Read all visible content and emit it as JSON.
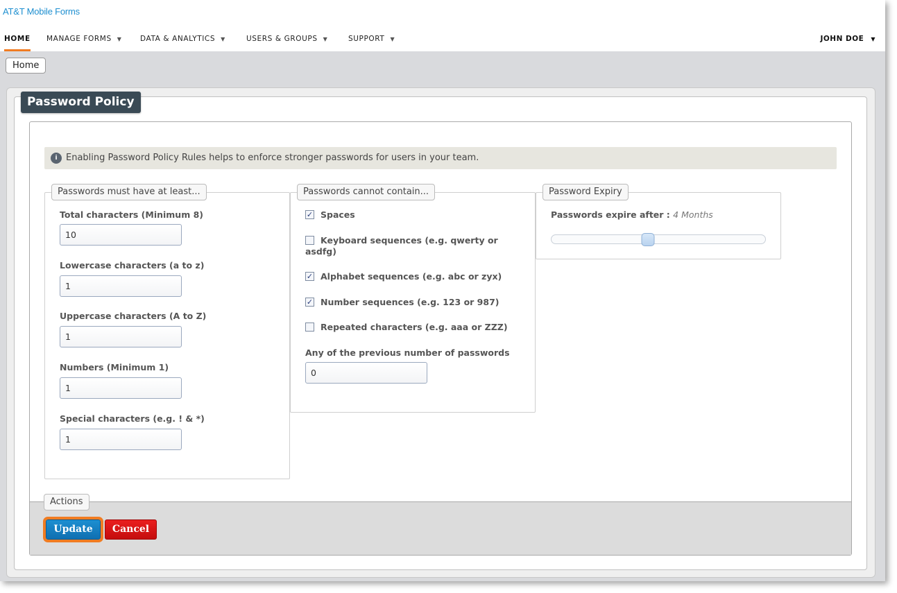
{
  "app": {
    "logo": "AT&T Mobile Forms"
  },
  "nav": {
    "items": [
      {
        "label": "HOME",
        "active": true,
        "has_caret": false
      },
      {
        "label": "MANAGE FORMS",
        "active": false,
        "has_caret": true
      },
      {
        "label": "DATA & ANALYTICS",
        "active": false,
        "has_caret": true
      },
      {
        "label": "USERS & GROUPS",
        "active": false,
        "has_caret": true
      },
      {
        "label": "SUPPORT",
        "active": false,
        "has_caret": true
      }
    ],
    "user": "JOHN DOE",
    "caret": "▼"
  },
  "breadcrumb": {
    "home": "Home"
  },
  "panel": {
    "title": "Password Policy"
  },
  "info": {
    "text": "Enabling Password Policy Rules helps to enforce stronger passwords for users in your team."
  },
  "must_have": {
    "legend": "Passwords must have at least...",
    "fields": [
      {
        "label": "Total characters (Minimum 8)",
        "value": "10"
      },
      {
        "label": "Lowercase characters (a to z)",
        "value": "1"
      },
      {
        "label": "Uppercase characters (A to Z)",
        "value": "1"
      },
      {
        "label": "Numbers (Minimum 1)",
        "value": "1"
      },
      {
        "label": "Special characters (e.g. ! & *)",
        "value": "1"
      }
    ]
  },
  "cannot_contain": {
    "legend": "Passwords cannot contain...",
    "options": [
      {
        "label": "Spaces",
        "checked": true
      },
      {
        "label": "Keyboard sequences (e.g. qwerty or asdfg)",
        "checked": false
      },
      {
        "label": "Alphabet sequences (e.g. abc or zyx)",
        "checked": true
      },
      {
        "label": "Number sequences (e.g. 123 or 987)",
        "checked": true
      },
      {
        "label": "Repeated characters (e.g. aaa or ZZZ)",
        "checked": false
      }
    ],
    "previous_label": "Any of the previous number of passwords",
    "previous_value": "0"
  },
  "expiry": {
    "legend": "Password Expiry",
    "label": "Passwords expire after :",
    "value": "4 Months",
    "slider_fraction": 0.45
  },
  "actions": {
    "legend": "Actions",
    "update": "Update",
    "cancel": "Cancel"
  },
  "colors": {
    "accent": "#f07c22",
    "logo": "#1e8fd0",
    "title_bg": "#3a4a55",
    "update": "#1d8fd1",
    "cancel": "#e01515"
  },
  "icons": {
    "info": "info-icon",
    "check": "✓"
  }
}
